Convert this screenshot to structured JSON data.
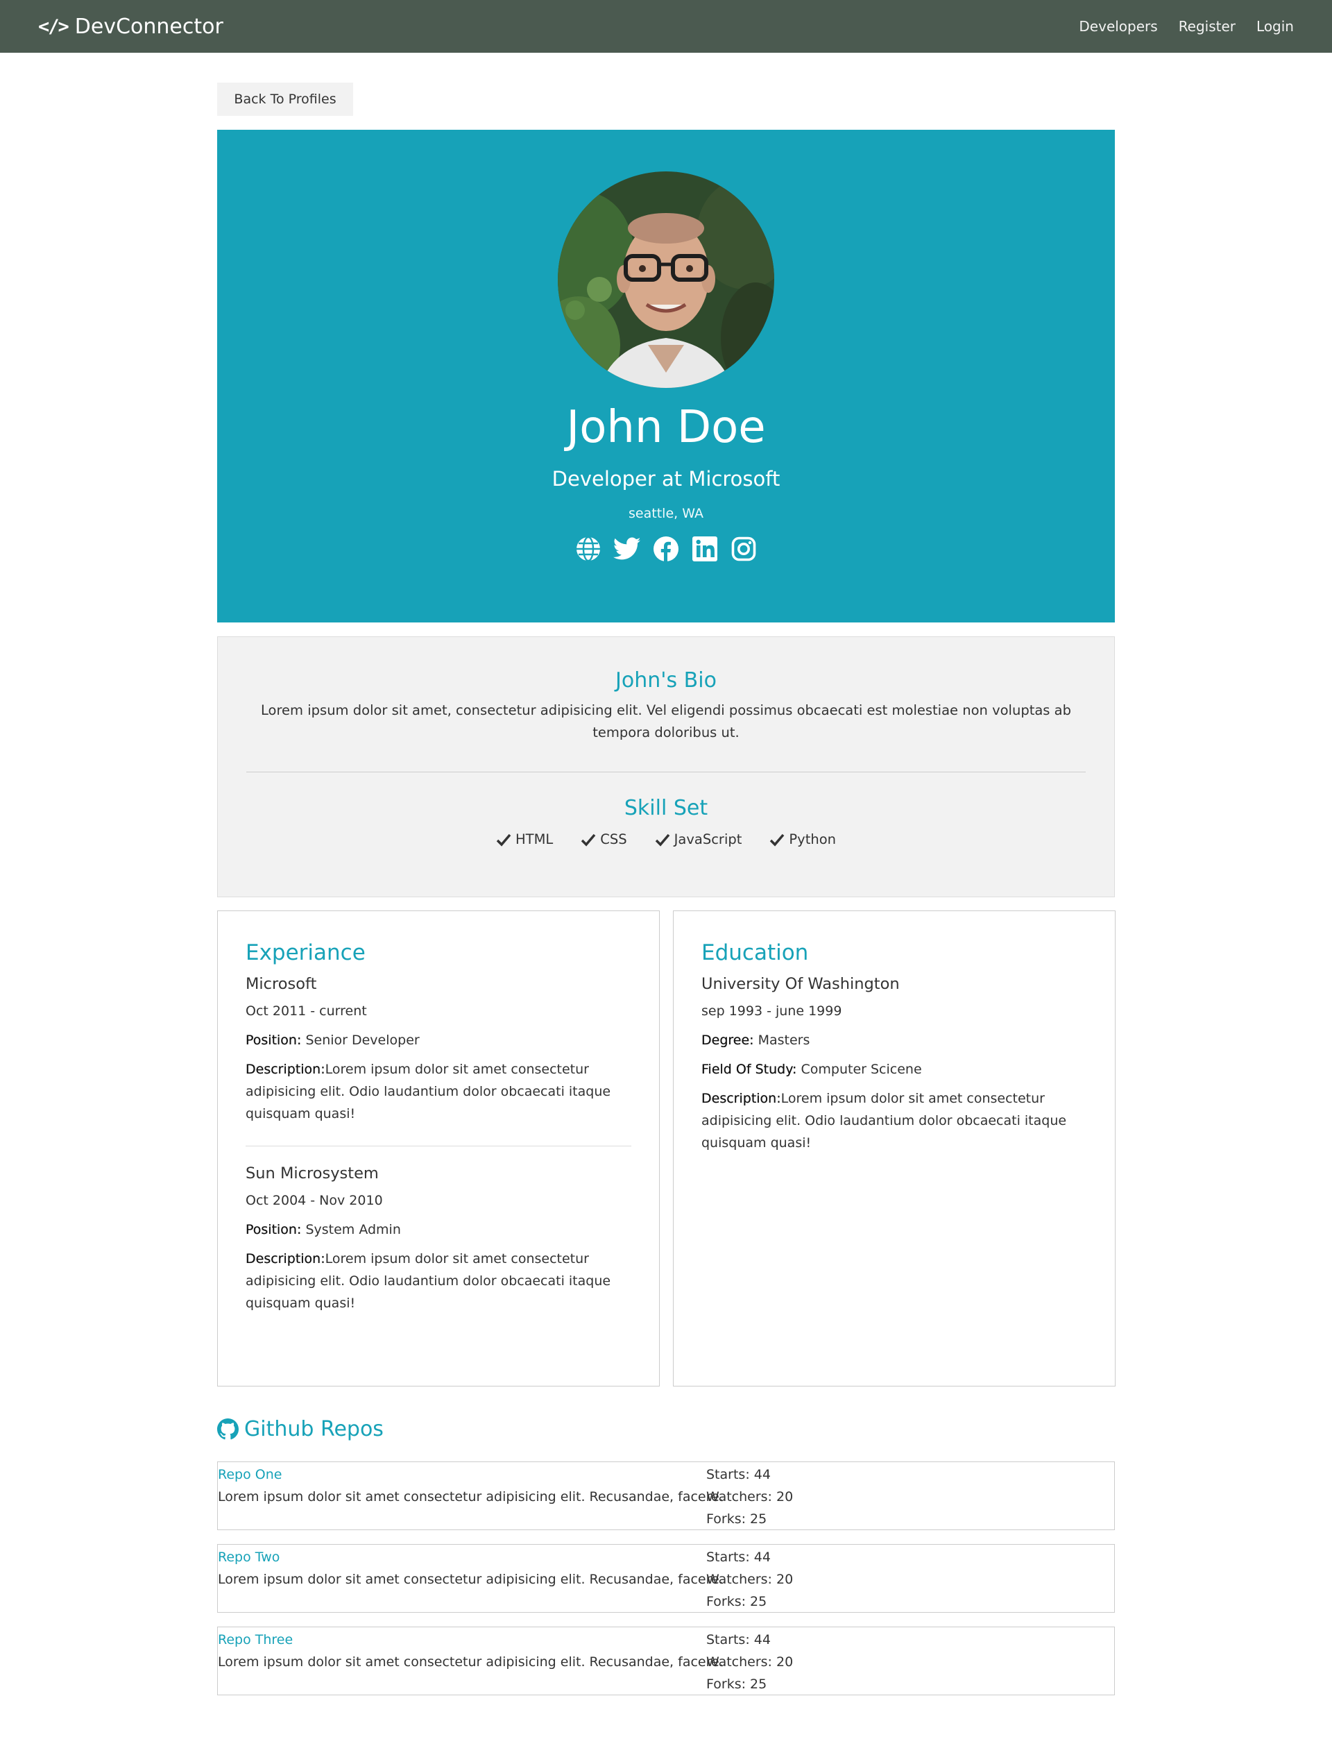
{
  "nav": {
    "brand": "DevConnector",
    "brand_icon": "code-icon",
    "links": [
      "Developers",
      "Register",
      "Login"
    ]
  },
  "back_button": "Back To Profiles",
  "profile": {
    "name": "John Doe",
    "status": "Developer at Microsoft",
    "location": "seattle, WA",
    "social_icons": [
      "globe-icon",
      "twitter-icon",
      "facebook-icon",
      "linkedin-icon",
      "instagram-icon"
    ],
    "accent": "#17a2b8"
  },
  "bio": {
    "title": "John's Bio",
    "text": "Lorem ipsum dolor sit amet, consectetur adipisicing elit. Vel eligendi possimus obcaecati est molestiae non voluptas ab tempora doloribus ut.",
    "skills_title": "Skill Set",
    "skills": [
      "HTML",
      "CSS",
      "JavaScript",
      "Python"
    ]
  },
  "experience": {
    "title": "Experiance",
    "entries": [
      {
        "company": "Microsoft",
        "dates": "Oct 2011 - current",
        "position_label": "Position:",
        "position": "Senior Developer",
        "description_label": "Description:",
        "description": "Lorem ipsum dolor sit amet consectetur adipisicing elit. Odio laudantium dolor obcaecati itaque quisquam quasi!"
      },
      {
        "company": "Sun Microsystem",
        "dates": "Oct 2004 - Nov 2010",
        "position_label": "Position:",
        "position": "System Admin",
        "description_label": "Description:",
        "description": "Lorem ipsum dolor sit amet consectetur adipisicing elit. Odio laudantium dolor obcaecati itaque quisquam quasi!"
      }
    ]
  },
  "education": {
    "title": "Education",
    "entries": [
      {
        "school": "University Of Washington",
        "dates": "sep 1993 - june 1999",
        "degree_label": "Degree:",
        "degree": "Masters",
        "field_label": "Field Of Study:",
        "field": "Computer Scicene",
        "description_label": "Description:",
        "description": "Lorem ipsum dolor sit amet consectetur adipisicing elit. Odio laudantium dolor obcaecati itaque quisquam quasi!"
      }
    ]
  },
  "repos": {
    "title": "Github Repos",
    "items": [
      {
        "name": "Repo One",
        "description": "Lorem ipsum dolor sit amet consectetur adipisicing elit. Recusandae, facere.",
        "stars": "Starts: 44",
        "watchers": "Watchers: 20",
        "forks": "Forks: 25"
      },
      {
        "name": "Repo Two",
        "description": "Lorem ipsum dolor sit amet consectetur adipisicing elit. Recusandae, facere.",
        "stars": "Starts: 44",
        "watchers": "Watchers: 20",
        "forks": "Forks: 25"
      },
      {
        "name": "Repo Three",
        "description": "Lorem ipsum dolor sit amet consectetur adipisicing elit. Recusandae, facere.",
        "stars": "Starts: 44",
        "watchers": "Watchers: 20",
        "forks": "Forks: 25"
      }
    ]
  }
}
